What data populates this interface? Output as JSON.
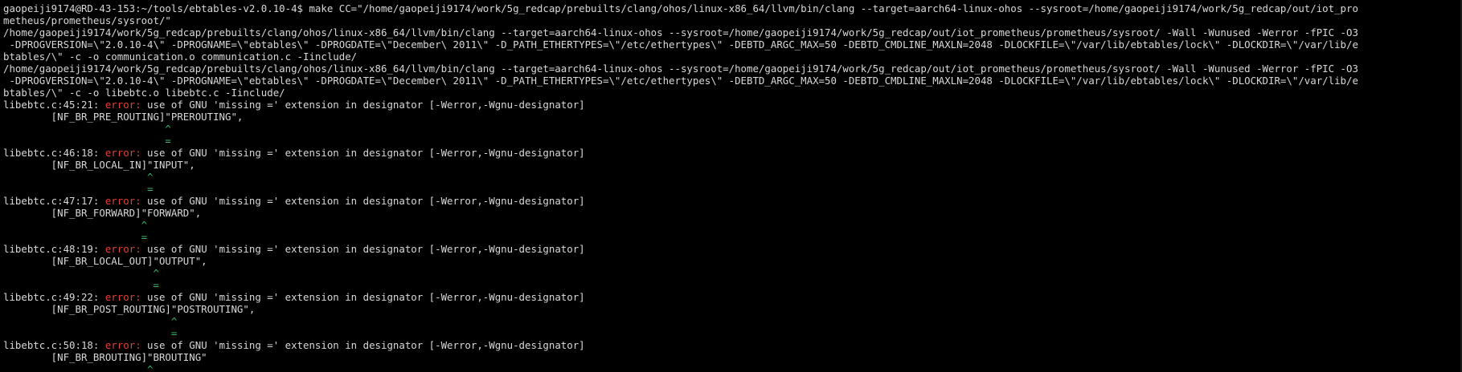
{
  "terminal": {
    "command_lines": [
      "gaopeiji9174@RD-43-153:~/tools/ebtables-v2.0.10-4$ make CC=\"/home/gaopeiji9174/work/5g_redcap/prebuilts/clang/ohos/linux-x86_64/llvm/bin/clang --target=aarch64-linux-ohos --sysroot=/home/gaopeiji9174/work/5g_redcap/out/iot_pro",
      "metheus/prometheus/sysroot/\"",
      "/home/gaopeiji9174/work/5g_redcap/prebuilts/clang/ohos/linux-x86_64/llvm/bin/clang --target=aarch64-linux-ohos --sysroot=/home/gaopeiji9174/work/5g_redcap/out/iot_prometheus/prometheus/sysroot/ -Wall -Wunused -Werror -fPIC -O3",
      " -DPROGVERSION=\\\"2.0.10-4\\\" -DPROGNAME=\\\"ebtables\\\" -DPROGDATE=\\\"December\\ 2011\\\" -D_PATH_ETHERTYPES=\\\"/etc/ethertypes\\\" -DEBTD_ARGC_MAX=50 -DEBTD_CMDLINE_MAXLN=2048 -DLOCKFILE=\\\"/var/lib/ebtables/lock\\\" -DLOCKDIR=\\\"/var/lib/e",
      "btables/\\\" -c -o communication.o communication.c -Iinclude/",
      "/home/gaopeiji9174/work/5g_redcap/prebuilts/clang/ohos/linux-x86_64/llvm/bin/clang --target=aarch64-linux-ohos --sysroot=/home/gaopeiji9174/work/5g_redcap/out/iot_prometheus/prometheus/sysroot/ -Wall -Wunused -Werror -fPIC -O3",
      " -DPROGVERSION=\\\"2.0.10-4\\\" -DPROGNAME=\\\"ebtables\\\" -DPROGDATE=\\\"December\\ 2011\\\" -D_PATH_ETHERTYPES=\\\"/etc/ethertypes\\\" -DEBTD_ARGC_MAX=50 -DEBTD_CMDLINE_MAXLN=2048 -DLOCKFILE=\\\"/var/lib/ebtables/lock\\\" -DLOCKDIR=\\\"/var/lib/e",
      "btables/\\\" -c -o libebtc.o libebtc.c -Iinclude/"
    ],
    "errors": [
      {
        "location": "libebtc.c:45:21: ",
        "error_label": "error:",
        "message": " use of GNU 'missing =' extension in designator [-Werror,-Wgnu-designator]",
        "source": "        [NF_BR_PRE_ROUTING]\"PREROUTING\",",
        "caret": "                           ^",
        "fixit": "                           ="
      },
      {
        "location": "libebtc.c:46:18: ",
        "error_label": "error:",
        "message": " use of GNU 'missing =' extension in designator [-Werror,-Wgnu-designator]",
        "source": "        [NF_BR_LOCAL_IN]\"INPUT\",",
        "caret": "                        ^",
        "fixit": "                        ="
      },
      {
        "location": "libebtc.c:47:17: ",
        "error_label": "error:",
        "message": " use of GNU 'missing =' extension in designator [-Werror,-Wgnu-designator]",
        "source": "        [NF_BR_FORWARD]\"FORWARD\",",
        "caret": "                       ^",
        "fixit": "                       ="
      },
      {
        "location": "libebtc.c:48:19: ",
        "error_label": "error:",
        "message": " use of GNU 'missing =' extension in designator [-Werror,-Wgnu-designator]",
        "source": "        [NF_BR_LOCAL_OUT]\"OUTPUT\",",
        "caret": "                         ^",
        "fixit": "                         ="
      },
      {
        "location": "libebtc.c:49:22: ",
        "error_label": "error:",
        "message": " use of GNU 'missing =' extension in designator [-Werror,-Wgnu-designator]",
        "source": "        [NF_BR_POST_ROUTING]\"POSTROUTING\",",
        "caret": "                            ^",
        "fixit": "                            ="
      },
      {
        "location": "libebtc.c:50:18: ",
        "error_label": "error:",
        "message": " use of GNU 'missing =' extension in designator [-Werror,-Wgnu-designator]",
        "source": "        [NF_BR_BROUTING]\"BROUTING\"",
        "caret": "                        ^",
        "fixit": ""
      }
    ]
  },
  "colors": {
    "background": "#000000",
    "text": "#d8d8d8",
    "error": "#e0403a",
    "fixit": "#3fb86e"
  }
}
